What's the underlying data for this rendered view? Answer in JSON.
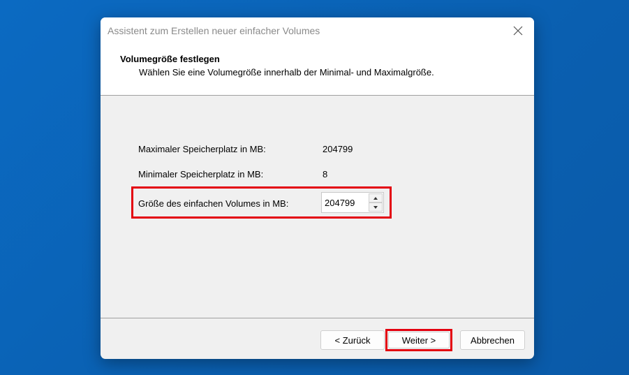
{
  "window": {
    "title": "Assistent zum Erstellen neuer einfacher Volumes",
    "close_icon": "close-icon"
  },
  "header": {
    "title": "Volumegröße festlegen",
    "subtitle": "Wählen Sie eine Volumegröße innerhalb der Minimal- und Maximalgröße."
  },
  "fields": {
    "max_label": "Maximaler Speicherplatz in MB:",
    "max_value": "204799",
    "min_label": "Minimaler Speicherplatz in MB:",
    "min_value": "8",
    "size_label": "Größe des einfachen Volumes in MB:",
    "size_value": "204799"
  },
  "buttons": {
    "back_label": "< Zurück",
    "next_label": "Weiter >",
    "cancel_label": "Abbrechen"
  },
  "colors": {
    "highlight": "#e3000f",
    "desktop_background": "#0a63b8"
  }
}
